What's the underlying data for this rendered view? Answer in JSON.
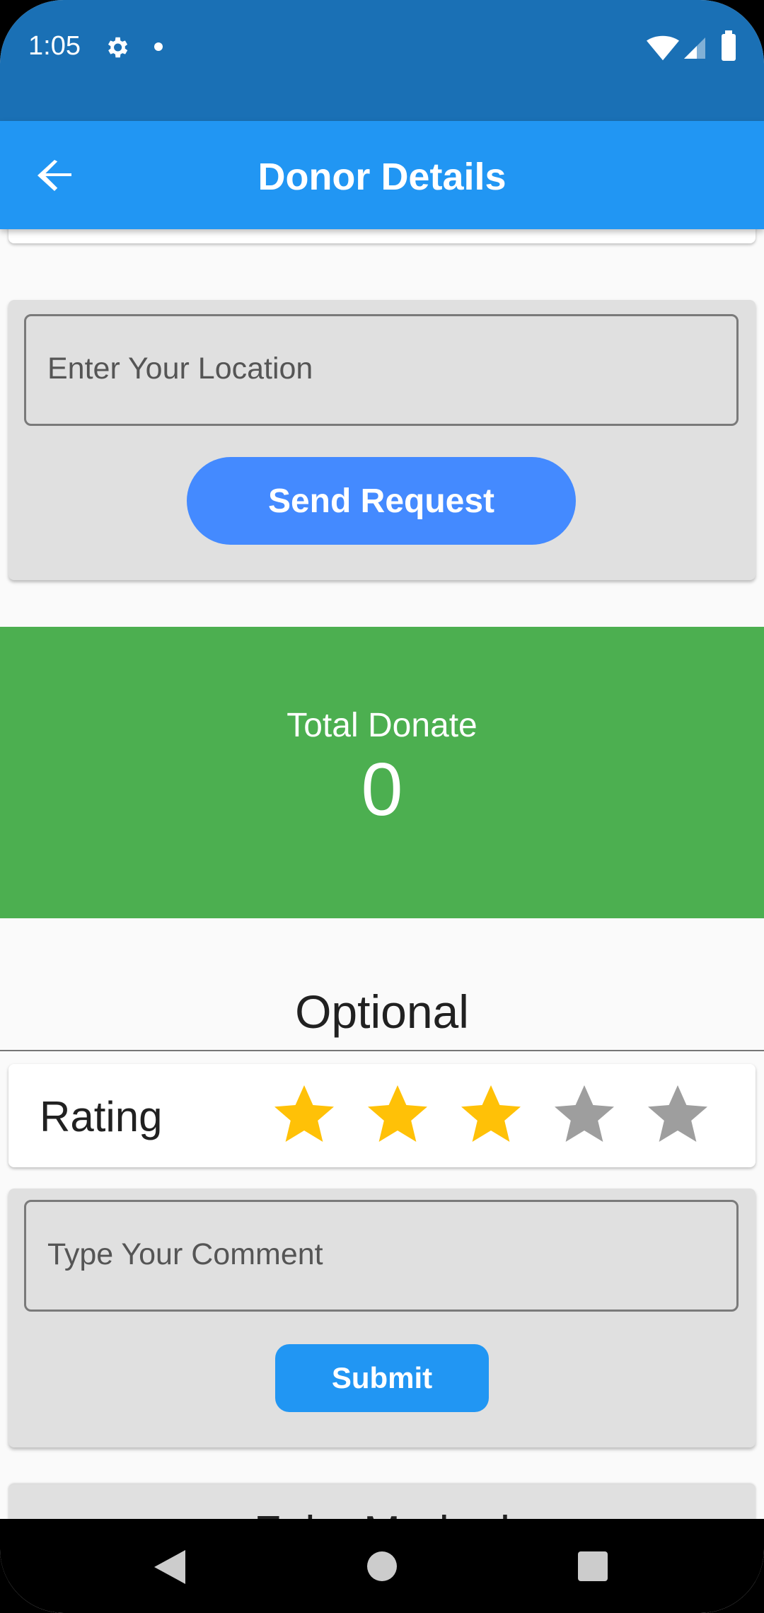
{
  "status_bar": {
    "time": "1:05"
  },
  "app_bar": {
    "title": "Donor Details"
  },
  "location": {
    "placeholder": "Enter Your Location",
    "send_label": "Send Request"
  },
  "total": {
    "label": "Total Donate",
    "value": "0"
  },
  "optional": {
    "title": "Optional"
  },
  "rating": {
    "label": "Rating",
    "value": 3,
    "max": 5
  },
  "comment": {
    "placeholder": "Type Your Comment",
    "submit_label": "Submit"
  },
  "bottom_card": {
    "title": "Fake Marked"
  },
  "colors": {
    "primary": "#2196f3",
    "status": "#1a70b5",
    "send": "#448aff",
    "total": "#4caf50",
    "star_on": "#ffc107",
    "star_off": "#9e9e9e"
  }
}
